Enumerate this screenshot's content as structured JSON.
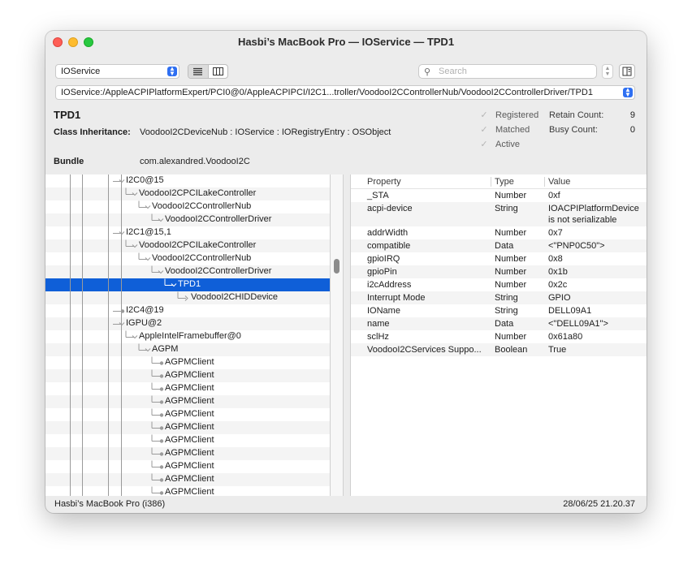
{
  "window": {
    "title": "Hasbi’s MacBook Pro — IOService — TPD1"
  },
  "toolbar": {
    "plane_select": "IOService",
    "search_placeholder": "Search",
    "view_mode_icons": [
      "list-view-icon",
      "column-view-icon"
    ],
    "inspector_icon": "inspector-icon"
  },
  "path": "IOService:/AppleACPIPlatformExpert/PCI0@0/AppleACPIPCI/I2C1...troller/VoodooI2CControllerNub/VoodooI2CControllerDriver/TPD1",
  "info": {
    "object_name": "TPD1",
    "class_inheritance_label": "Class Inheritance:",
    "class_inheritance_value": "VoodooI2CDeviceNub : IOService : IORegistryEntry : OSObject",
    "bundle_label": "Bundle",
    "bundle_value": "com.alexandred.VoodooI2C",
    "checks": [
      {
        "label": "Registered",
        "checked": true
      },
      {
        "label": "Matched",
        "checked": true
      },
      {
        "label": "Active",
        "checked": true
      }
    ],
    "retain_count_label": "Retain Count:",
    "retain_count": "9",
    "busy_count_label": "Busy Count:",
    "busy_count": "0"
  },
  "tree": [
    {
      "label": "I2C0@15",
      "depth": 0
    },
    {
      "label": "VoodooI2CPCILakeController",
      "depth": 1
    },
    {
      "label": "VoodooI2CControllerNub",
      "depth": 2
    },
    {
      "label": "VoodooI2CControllerDriver",
      "depth": 3
    },
    {
      "label": "I2C1@15,1",
      "depth": 0
    },
    {
      "label": "VoodooI2CPCILakeController",
      "depth": 1
    },
    {
      "label": "VoodooI2CControllerNub",
      "depth": 2
    },
    {
      "label": "VoodooI2CControllerDriver",
      "depth": 3
    },
    {
      "label": "TPD1",
      "depth": 4,
      "selected": true
    },
    {
      "label": "VoodooI2CHIDDevice",
      "depth": 5
    },
    {
      "label": "I2C4@19",
      "depth": 0
    },
    {
      "label": "IGPU@2",
      "depth": 0
    },
    {
      "label": "AppleIntelFramebuffer@0",
      "depth": 1
    },
    {
      "label": "AGPM",
      "depth": 2
    },
    {
      "label": "AGPMClient",
      "depth": 3
    },
    {
      "label": "AGPMClient",
      "depth": 3
    },
    {
      "label": "AGPMClient",
      "depth": 3
    },
    {
      "label": "AGPMClient",
      "depth": 3
    },
    {
      "label": "AGPMClient",
      "depth": 3
    },
    {
      "label": "AGPMClient",
      "depth": 3
    },
    {
      "label": "AGPMClient",
      "depth": 3
    },
    {
      "label": "AGPMClient",
      "depth": 3
    },
    {
      "label": "AGPMClient",
      "depth": 3
    },
    {
      "label": "AGPMClient",
      "depth": 3
    },
    {
      "label": "AGPMClient",
      "depth": 3
    }
  ],
  "properties": {
    "headers": [
      "Property",
      "Type",
      "Value"
    ],
    "rows": [
      {
        "name": "_STA",
        "type": "Number",
        "value": "0xf"
      },
      {
        "name": "acpi-device",
        "type": "String",
        "value": "IOACPIPlatformDevice",
        "value2": "is not serializable"
      },
      {
        "name": "addrWidth",
        "type": "Number",
        "value": "0x7"
      },
      {
        "name": "compatible",
        "type": "Data",
        "value": "<\"PNP0C50\">"
      },
      {
        "name": "gpioIRQ",
        "type": "Number",
        "value": "0x8"
      },
      {
        "name": "gpioPin",
        "type": "Number",
        "value": "0x1b"
      },
      {
        "name": "i2cAddress",
        "type": "Number",
        "value": "0x2c"
      },
      {
        "name": "Interrupt Mode",
        "type": "String",
        "value": "GPIO"
      },
      {
        "name": "IOName",
        "type": "String",
        "value": "DELL09A1"
      },
      {
        "name": "name",
        "type": "Data",
        "value": "<\"DELL09A1\">"
      },
      {
        "name": "sclHz",
        "type": "Number",
        "value": "0x61a80"
      },
      {
        "name": "VoodooI2CServices Suppo...",
        "type": "Boolean",
        "value": "True"
      }
    ]
  },
  "status": {
    "machine": "Hasbi’s MacBook Pro (i386)",
    "timestamp": "28/06/25 21.20.37"
  },
  "colors": {
    "selection": "#0f5fd8",
    "accent": "#2e6ff2",
    "close": "#fe5f57",
    "minimize": "#febc2e",
    "zoom": "#28c840"
  }
}
